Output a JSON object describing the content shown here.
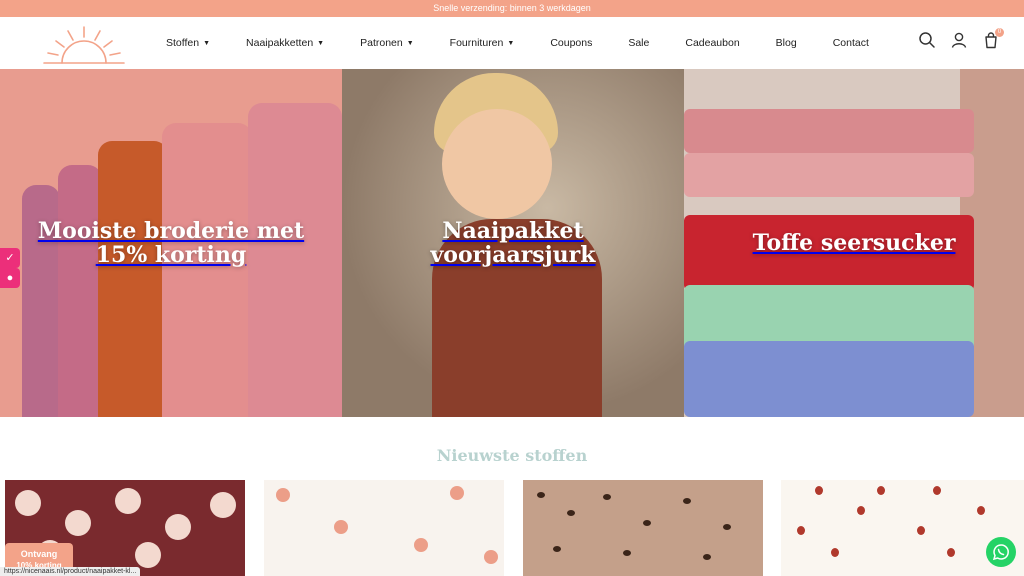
{
  "topbar": {
    "text": "Snelle verzending: binnen 3 werkdagen"
  },
  "nav": {
    "items": [
      {
        "label": "Stoffen",
        "dropdown": true
      },
      {
        "label": "Naaipakketten",
        "dropdown": true
      },
      {
        "label": "Patronen",
        "dropdown": true
      },
      {
        "label": "Fournituren",
        "dropdown": true
      },
      {
        "label": "Coupons",
        "dropdown": false
      },
      {
        "label": "Sale",
        "dropdown": false
      },
      {
        "label": "Cadeaubon",
        "dropdown": false
      },
      {
        "label": "Blog",
        "dropdown": false
      },
      {
        "label": "Contact",
        "dropdown": false
      }
    ]
  },
  "header_icons": [
    "search-icon",
    "user-icon",
    "cart-icon"
  ],
  "cart": {
    "count": "0"
  },
  "hero": {
    "panels": [
      {
        "title": "Mooiste broderie met 15% korting"
      },
      {
        "title": "Naaipakket voorjaarsjurk"
      },
      {
        "title": "Toffe seersucker"
      }
    ]
  },
  "section": {
    "title": "Nieuwste stoffen"
  },
  "promo": {
    "line1": "Ontvang",
    "line2": "10% korting"
  },
  "statusbar": {
    "url": "https://nicenaais.nl/product/naaipakket-kl..."
  },
  "colors": {
    "accent": "#f3a389",
    "section_title": "#b8d2cf",
    "whatsapp": "#25d366",
    "side_tab": "#ec2f7a"
  }
}
